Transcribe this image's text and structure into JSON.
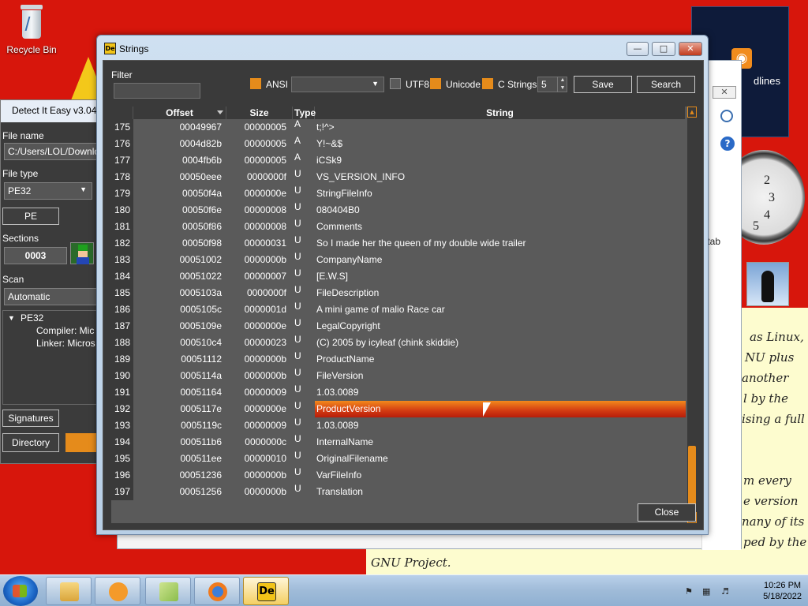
{
  "desktop": {
    "recycle_bin_label": "Recycle Bin",
    "feed_gadget_text": "dlines",
    "bg_window_partial_text": "tab",
    "clock_numbers": [
      "2",
      "3",
      "4",
      "5"
    ],
    "note_lines": [
      "as Linux,",
      "NU plus",
      "another",
      "l by the",
      "ising a full",
      "m every",
      "e version",
      "nany of its",
      "ped by the",
      "GNU Project."
    ]
  },
  "die_window": {
    "title": "Detect It Easy v3.04 [",
    "file_name_label": "File name",
    "file_name_value": "C:/Users/LOL/Download",
    "file_type_label": "File type",
    "file_type_value": "PE32",
    "pe_button": "PE",
    "sections_label": "Sections",
    "sections_value": "0003",
    "scan_label": "Scan",
    "scan_value": "Automatic",
    "tree_root": "PE32",
    "tree_compiler": "Compiler: Mic",
    "tree_linker": "Linker: Micros",
    "signatures_button": "Signatures",
    "directory_button": "Directory"
  },
  "strings_dialog": {
    "title": "Strings",
    "app_icon_text": "De",
    "filter_label": "Filter",
    "filter_value": "",
    "ansi_label": "ANSI",
    "ansi_checked": true,
    "utf8_label": "UTF8",
    "utf8_checked": false,
    "unicode_label": "Unicode",
    "unicode_checked": true,
    "cstrings_label": "C Strings",
    "cstrings_checked": true,
    "min_length": "5",
    "save_button": "Save",
    "search_button": "Search",
    "close_button": "Close",
    "columns": [
      "Offset",
      "Size",
      "Type",
      "String"
    ],
    "selected_index": 17,
    "rows": [
      {
        "n": "175",
        "offset": "00049967",
        "size": "00000005",
        "type": "A",
        "string": "t;!^>"
      },
      {
        "n": "176",
        "offset": "0004d82b",
        "size": "00000005",
        "type": "A",
        "string": "Y!~&$"
      },
      {
        "n": "177",
        "offset": "0004fb6b",
        "size": "00000005",
        "type": "A",
        "string": "iCSk9"
      },
      {
        "n": "178",
        "offset": "00050eee",
        "size": "0000000f",
        "type": "U",
        "string": "VS_VERSION_INFO"
      },
      {
        "n": "179",
        "offset": "00050f4a",
        "size": "0000000e",
        "type": "U",
        "string": "StringFileInfo"
      },
      {
        "n": "180",
        "offset": "00050f6e",
        "size": "00000008",
        "type": "U",
        "string": "080404B0"
      },
      {
        "n": "181",
        "offset": "00050f86",
        "size": "00000008",
        "type": "U",
        "string": "Comments"
      },
      {
        "n": "182",
        "offset": "00050f98",
        "size": "00000031",
        "type": "U",
        "string": "So I made her the queen of my double wide trailer"
      },
      {
        "n": "183",
        "offset": "00051002",
        "size": "0000000b",
        "type": "U",
        "string": "CompanyName"
      },
      {
        "n": "184",
        "offset": "00051022",
        "size": "00000007",
        "type": "U",
        "string": "[E.W.S]"
      },
      {
        "n": "185",
        "offset": "0005103a",
        "size": "0000000f",
        "type": "U",
        "string": "FileDescription"
      },
      {
        "n": "186",
        "offset": "0005105c",
        "size": "0000001d",
        "type": "U",
        "string": "A mini game of malio Race car"
      },
      {
        "n": "187",
        "offset": "0005109e",
        "size": "0000000e",
        "type": "U",
        "string": "LegalCopyright"
      },
      {
        "n": "188",
        "offset": "000510c4",
        "size": "00000023",
        "type": "U",
        "string": "(C) 2005 by icyleaf (chink skiddie)"
      },
      {
        "n": "189",
        "offset": "00051112",
        "size": "0000000b",
        "type": "U",
        "string": "ProductName"
      },
      {
        "n": "190",
        "offset": "0005114a",
        "size": "0000000b",
        "type": "U",
        "string": "FileVersion"
      },
      {
        "n": "191",
        "offset": "00051164",
        "size": "00000009",
        "type": "U",
        "string": "1.03.0089"
      },
      {
        "n": "192",
        "offset": "0005117e",
        "size": "0000000e",
        "type": "U",
        "string": "ProductVersion"
      },
      {
        "n": "193",
        "offset": "0005119c",
        "size": "00000009",
        "type": "U",
        "string": "1.03.0089"
      },
      {
        "n": "194",
        "offset": "000511b6",
        "size": "0000000c",
        "type": "U",
        "string": "InternalName"
      },
      {
        "n": "195",
        "offset": "000511ee",
        "size": "00000010",
        "type": "U",
        "string": "OriginalFilename"
      },
      {
        "n": "196",
        "offset": "00051236",
        "size": "0000000b",
        "type": "U",
        "string": "VarFileInfo"
      },
      {
        "n": "197",
        "offset": "00051256",
        "size": "0000000b",
        "type": "U",
        "string": "Translation"
      }
    ]
  },
  "taskbar": {
    "pinned": [
      "explorer-icon",
      "media-player-icon",
      "libraries-icon",
      "firefox-icon",
      "detect-it-easy-icon"
    ],
    "time": "10:26 PM",
    "date": "5/18/2022"
  },
  "colors": {
    "desktop_bg": "#d7160c",
    "accent_orange": "#e58b1b",
    "dialog_bg": "#3a3a3a",
    "table_bg": "#5a5a5a"
  }
}
